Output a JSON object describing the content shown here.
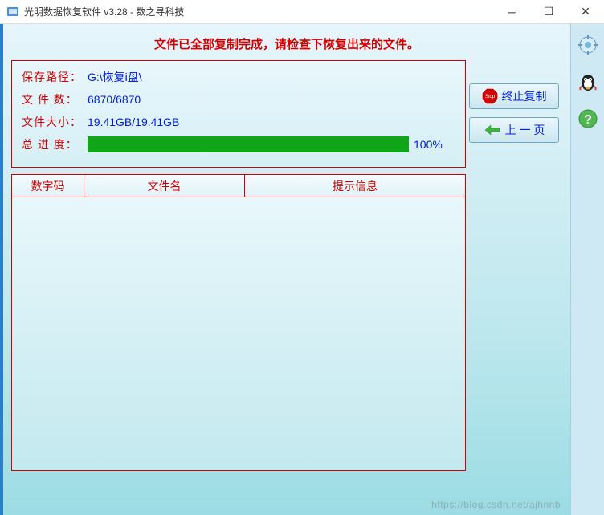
{
  "window": {
    "title": "光明数据恢复软件 v3.28 - 数之寻科技"
  },
  "status_message": "文件已全部复制完成，请检查下恢复出来的文件。",
  "info": {
    "save_path_label": "保存路径：",
    "save_path_value": "G:\\恢复i盘\\",
    "file_count_label": "文 件 数：",
    "file_count_value": "6870/6870",
    "file_size_label": "文件大小：",
    "file_size_value": "19.41GB/19.41GB",
    "progress_label": "总 进 度：",
    "progress_pct": "100%"
  },
  "buttons": {
    "stop_copy": "终止复制",
    "prev_page": "上 一 页"
  },
  "table": {
    "headers": {
      "code": "数字码",
      "filename": "文件名",
      "message": "提示信息"
    }
  },
  "watermark": "https://blog.csdn.net/ajhnnb"
}
